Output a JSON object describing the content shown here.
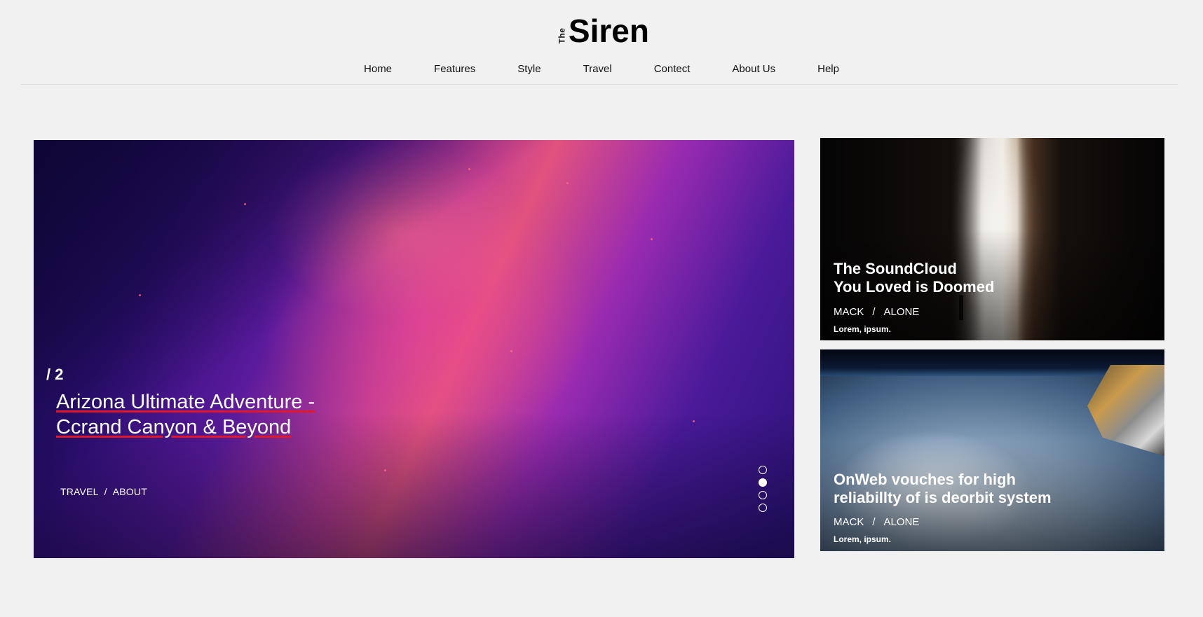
{
  "brand": {
    "the": "The",
    "name": "Siren"
  },
  "nav": {
    "items": [
      "Home",
      "Features",
      "Style",
      "Travel",
      "Contect",
      "About Us",
      "Help"
    ]
  },
  "hero": {
    "counter": "/ 2",
    "title_line1": "Arizona Ultimate Adventure -",
    "title_line2": "Ccrand Canyon & Beyond",
    "category": "TRAVEL",
    "separator": "/",
    "tag": "ABOUT",
    "slides_total": 4,
    "active_slide": 2
  },
  "cards": [
    {
      "title_line1": "The SoundCloud",
      "title_line2": "You Loved is Doomed",
      "author": "MACK",
      "separator": "/",
      "tag": "ALONE",
      "excerpt": "Lorem, ipsum."
    },
    {
      "title_line1": "OnWeb vouches for high",
      "title_line2": "reliabillty of is deorbit system",
      "author": "MACK",
      "separator": "/",
      "tag": "ALONE",
      "excerpt": "Lorem, ipsum."
    }
  ],
  "colors": {
    "background": "#f1f1f1",
    "accent_underline": "#e0182e",
    "text": "#111111"
  }
}
